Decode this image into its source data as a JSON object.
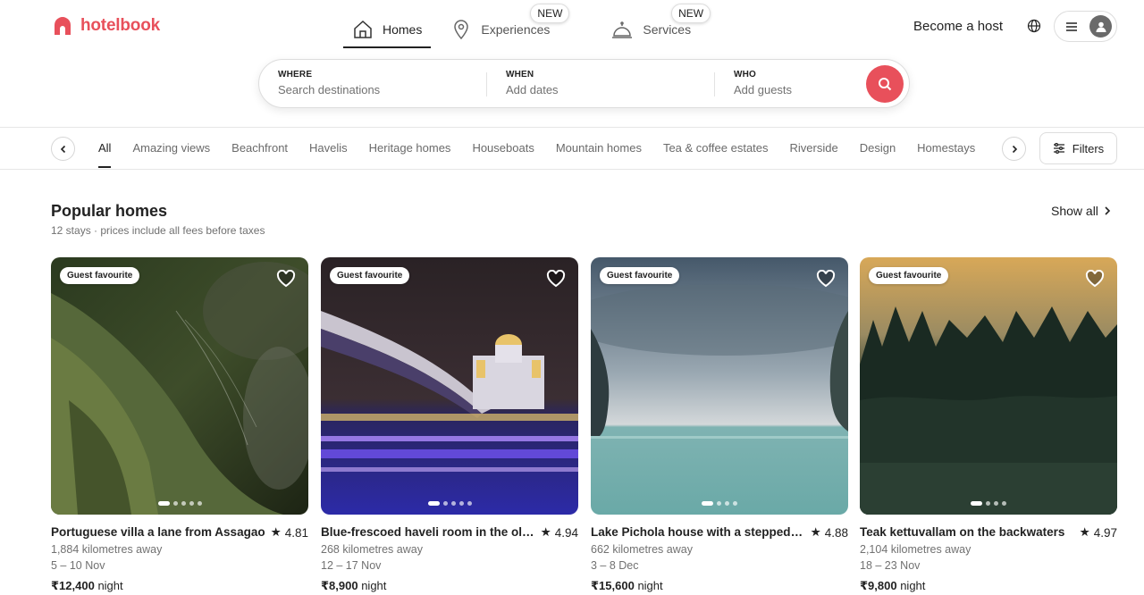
{
  "brand": {
    "name": "hotelbook",
    "color": "#e8505b"
  },
  "topnav": [
    {
      "label": "Homes",
      "icon": "house-icon",
      "active": true
    },
    {
      "label": "Experiences",
      "icon": "map-pin-icon",
      "badge": "NEW"
    },
    {
      "label": "Services",
      "icon": "service-bell-icon",
      "badge": "NEW"
    }
  ],
  "header": {
    "host_label": "Become a host"
  },
  "search": {
    "where": {
      "label": "WHERE",
      "placeholder": "Search destinations"
    },
    "when": {
      "label": "WHEN",
      "placeholder": "Add dates"
    },
    "who": {
      "label": "WHO",
      "placeholder": "Add guests"
    }
  },
  "categories": [
    "All",
    "Amazing views",
    "Beachfront",
    "Havelis",
    "Heritage homes",
    "Houseboats",
    "Mountain homes",
    "Tea & coffee estates",
    "Riverside",
    "Design",
    "Homestays"
  ],
  "filters_label": "Filters",
  "section": {
    "title": "Popular homes",
    "subtitle": "12 stays · prices include all fees before taxes",
    "show_all": "Show all"
  },
  "listings": [
    {
      "badge": "Guest favourite",
      "title": "Portuguese villa a lane from Assagao",
      "rating": "4.81",
      "distance": "1,884 kilometres away",
      "dates": "5 – 10 Nov",
      "price": "₹12,400",
      "price_unit": "night"
    },
    {
      "badge": "Guest favourite",
      "title": "Blue-frescoed haveli room in the old city",
      "rating": "4.94",
      "distance": "268 kilometres away",
      "dates": "12 – 17 Nov",
      "price": "₹8,900",
      "price_unit": "night"
    },
    {
      "badge": "Guest favourite",
      "title": "Lake Pichola house with a stepped ghat",
      "rating": "4.88",
      "distance": "662 kilometres away",
      "dates": "3 – 8 Dec",
      "price": "₹15,600",
      "price_unit": "night"
    },
    {
      "badge": "Guest favourite",
      "title": "Teak kettuvallam on the backwaters",
      "rating": "4.97",
      "distance": "2,104 kilometres away",
      "dates": "18 – 23 Nov",
      "price": "₹9,800",
      "price_unit": "night"
    }
  ]
}
